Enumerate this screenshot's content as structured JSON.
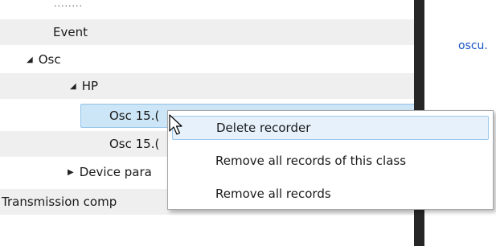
{
  "tree": {
    "ellipsis": "........",
    "rows": [
      {
        "label": "Event"
      },
      {
        "label": "Osc",
        "expanded_glyph": "◢"
      },
      {
        "label": "HP",
        "expanded_glyph": "◢"
      },
      {
        "label": "Osc 15.(",
        "selected": true
      },
      {
        "label": "Osc 15.("
      },
      {
        "label": "Device para",
        "collapsed_glyph": "▶"
      },
      {
        "label": "Transmission comp"
      }
    ]
  },
  "right_panel": {
    "link_text": "oscu."
  },
  "context_menu": {
    "items": [
      {
        "label": "Delete recorder",
        "highlighted": true
      },
      {
        "label": "Remove all records of this class"
      },
      {
        "label": "Remove all records"
      }
    ]
  },
  "colors": {
    "selection_bg": "#cde6f7",
    "menu_hover_bg": "#e6f1fb",
    "link": "#1a56c4",
    "divider": "#262626"
  },
  "icons": {
    "cursor": "arrow-cursor-icon"
  }
}
